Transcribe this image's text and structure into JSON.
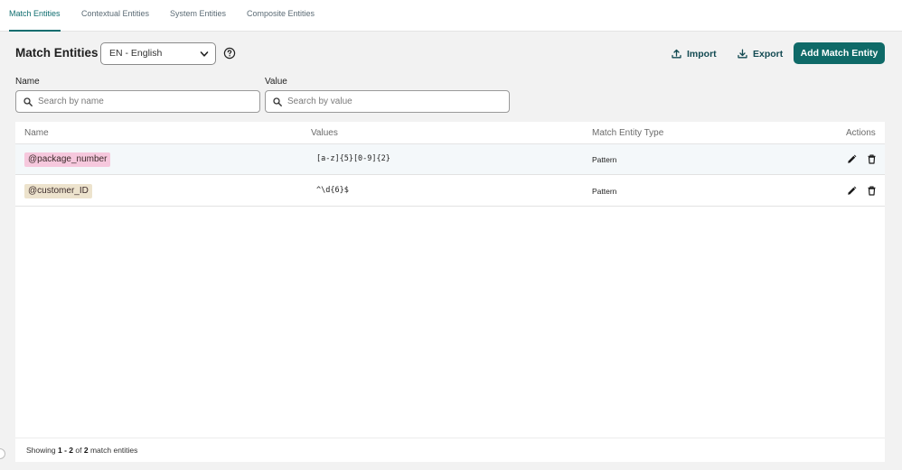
{
  "tabs": [
    {
      "label": "Match Entities",
      "active": true
    },
    {
      "label": "Contextual Entities",
      "active": false
    },
    {
      "label": "System Entities",
      "active": false
    },
    {
      "label": "Composite Entities",
      "active": false
    }
  ],
  "header": {
    "title": "Match Entities",
    "language_selected": "EN - English",
    "help_icon": "question-circle-icon",
    "import_label": "Import",
    "export_label": "Export",
    "add_label": "Add Match Entity"
  },
  "filters": {
    "name_label": "Name",
    "name_placeholder": "Search by name",
    "name_value": "",
    "value_label": "Value",
    "value_placeholder": "Search by value",
    "value_value": ""
  },
  "table": {
    "columns": [
      "Name",
      "Values",
      "Match Entity Type",
      "Actions"
    ],
    "rows": [
      {
        "name": "@package_number",
        "value": "[a-z]{5}[0-9]{2}",
        "type": "Pattern",
        "chip_color": "#f6c8dd"
      },
      {
        "name": "@customer_ID",
        "value": "^\\d{6}$",
        "type": "Pattern",
        "chip_color": "#ede3cd"
      }
    ]
  },
  "footer": {
    "prefix": "Showing",
    "range": "1 - 2",
    "of": "of",
    "total": "2",
    "suffix": "match entities"
  },
  "colors": {
    "accent": "#0f6a68",
    "tab_active": "#0f6d6f",
    "row_highlight": "#f4f8fa"
  }
}
